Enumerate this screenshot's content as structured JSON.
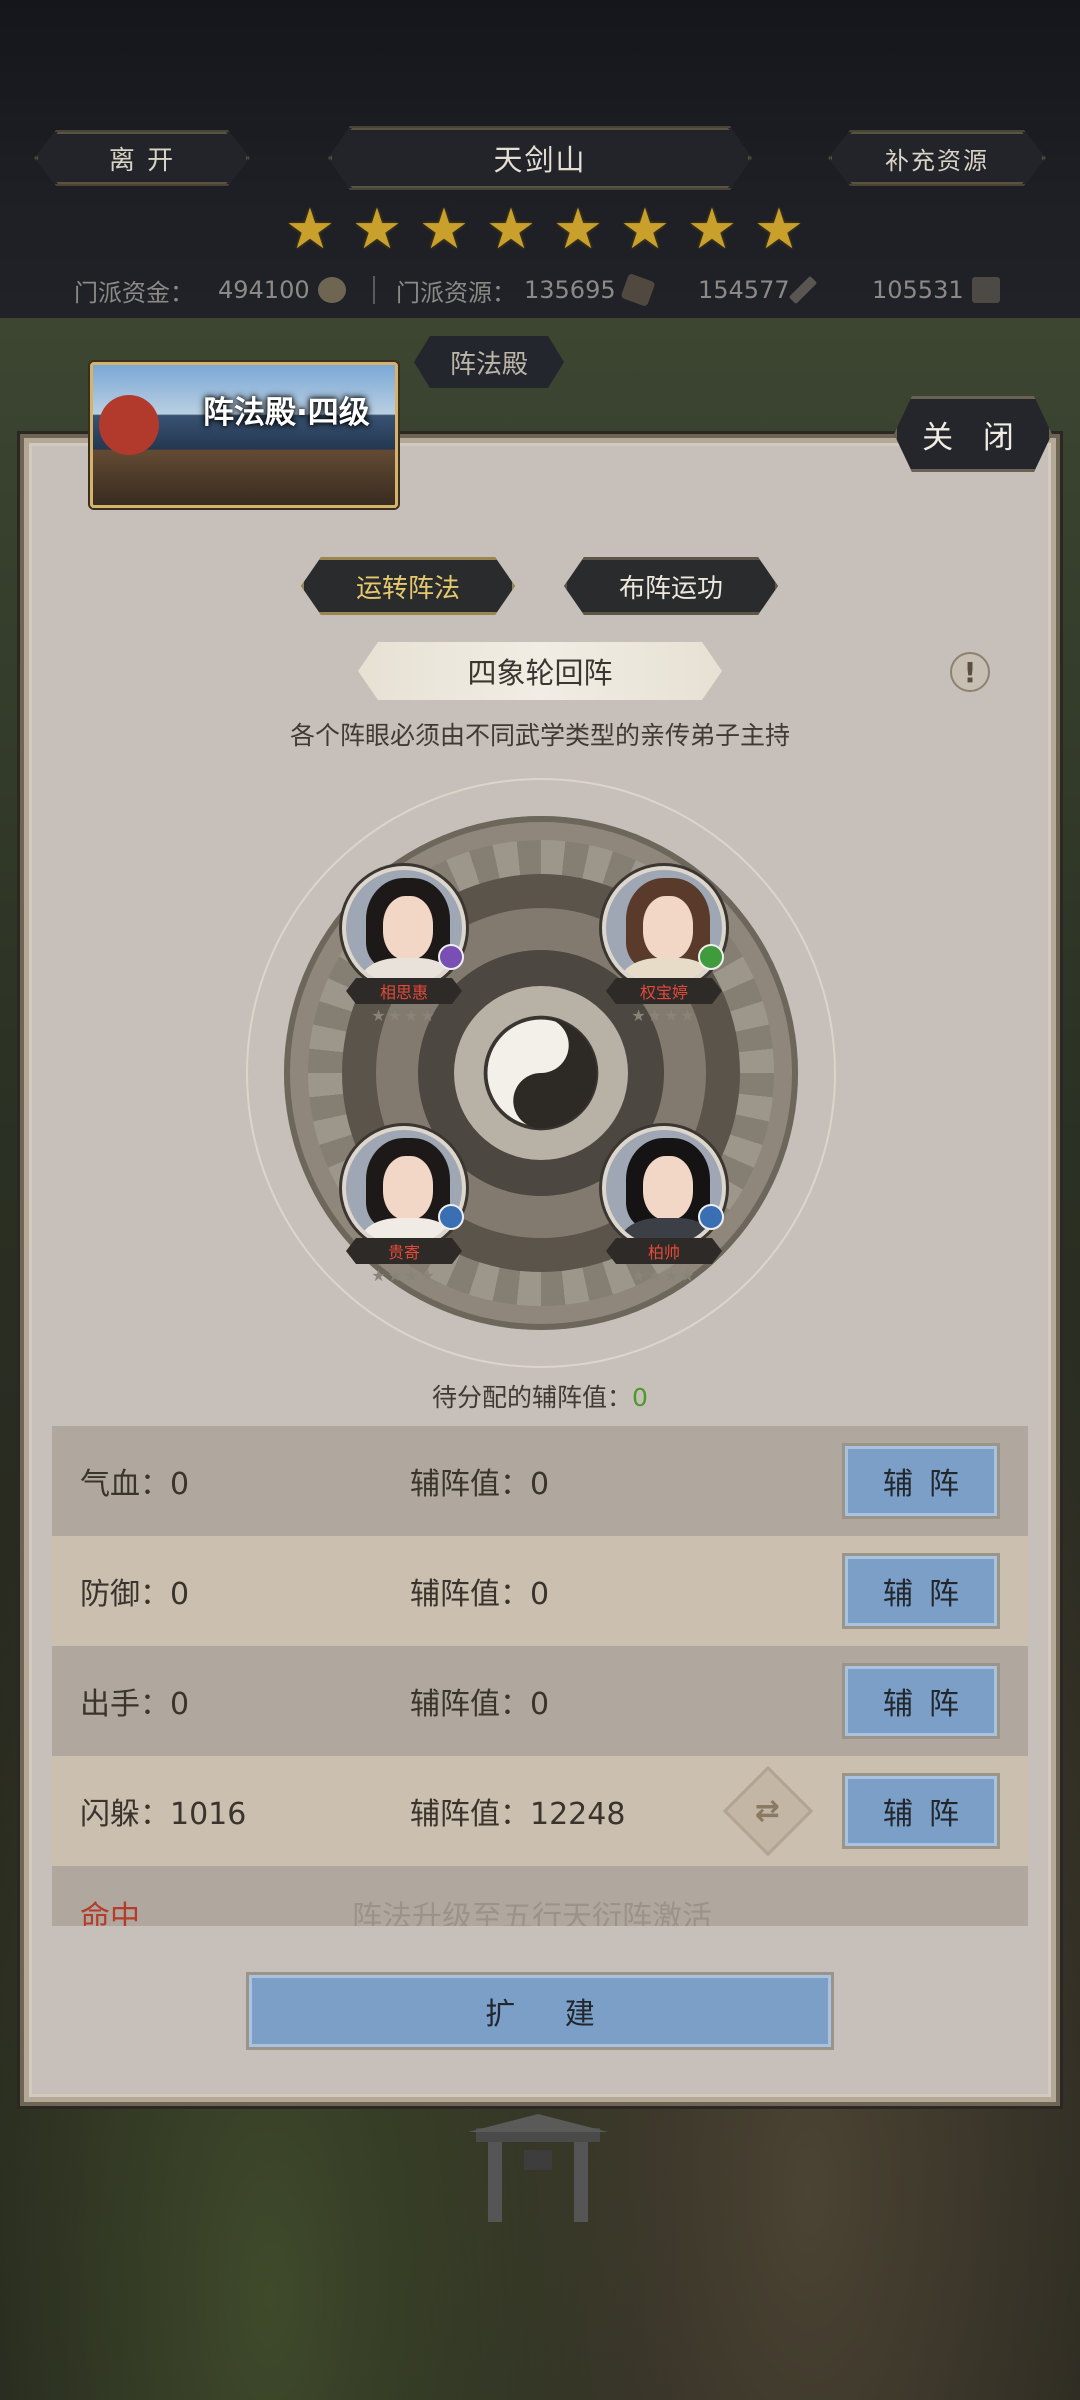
{
  "header": {
    "leave_label": "离 开",
    "location_title": "天剑山",
    "replenish_label": "补充资源",
    "star_count": 8,
    "resources": {
      "funds_label": "门派资金：",
      "funds_value": "494100",
      "materials_label": "门派资源：",
      "materials_value": "135695",
      "res2_value": "154577",
      "res3_value": "105531"
    }
  },
  "hall_tab_label": "阵法殿",
  "title_card": {
    "text": "阵法殿·四级"
  },
  "close_label": "关 闭",
  "tabs": [
    {
      "label": "运转阵法",
      "active": true
    },
    {
      "label": "布阵运功",
      "active": false
    }
  ],
  "formation": {
    "name": "四象轮回阵",
    "hint": "各个阵眼必须由不同武学类型的亲传弟子主持",
    "info_icon": "!",
    "seats": [
      {
        "name": "相思惠",
        "badge_color": "#7a4fb3"
      },
      {
        "name": "权宝婷",
        "badge_color": "#3f9b3c"
      },
      {
        "name": "贵寄",
        "badge_color": "#3a6fb4"
      },
      {
        "name": "柏帅",
        "badge_color": "#3a6fb4"
      }
    ],
    "seat_stars": "★★★★"
  },
  "pending": {
    "label": "待分配的辅阵值：",
    "value": "0"
  },
  "stats": [
    {
      "label": "气血：0",
      "sub": "辅阵值：0",
      "button": "辅阵"
    },
    {
      "label": "防御：0",
      "sub": "辅阵值：0",
      "button": "辅阵"
    },
    {
      "label": "出手：0",
      "sub": "辅阵值：0",
      "button": "辅阵"
    },
    {
      "label": "闪躲：1016",
      "sub": "辅阵值：12248",
      "button": "辅阵"
    }
  ],
  "locked_row": {
    "label": "命中",
    "text": "阵法升级至五行天衍阵激活"
  },
  "expand_label": "扩 建",
  "colors": {
    "accent_blue": "#7b9fc6",
    "gold": "#caa02c",
    "active_tab_text": "#e6c96d",
    "pending_value": "#4c9a2a"
  }
}
